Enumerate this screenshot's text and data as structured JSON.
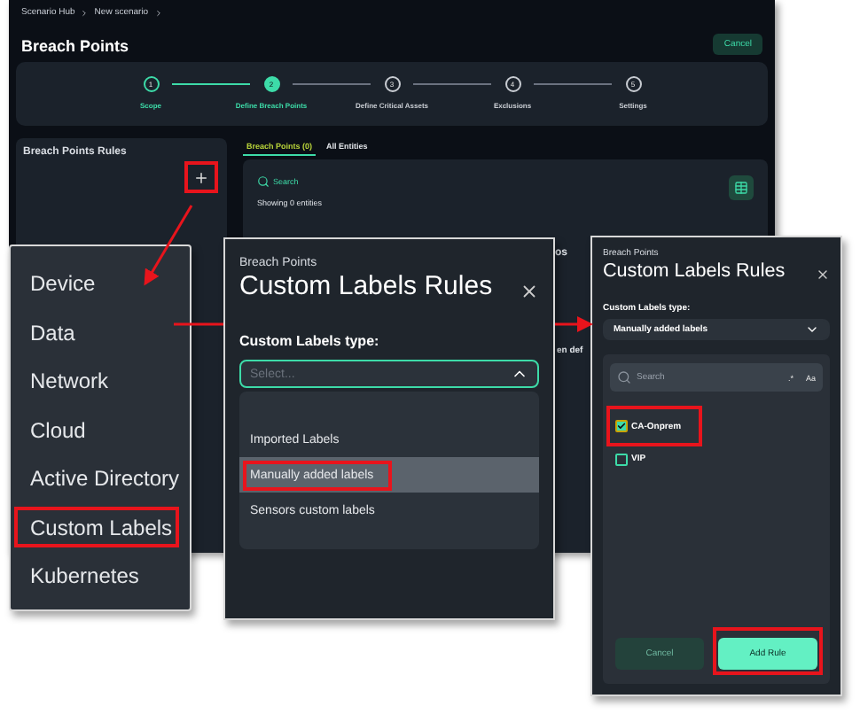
{
  "breadcrumb": [
    "Scenario Hub",
    "New scenario"
  ],
  "page_title": "Breach Points",
  "cancel_button": "Cancel",
  "steps": [
    {
      "number": "1",
      "label": "Scope",
      "completed": true,
      "selected": false
    },
    {
      "number": "2",
      "label": "Define Breach Points",
      "completed": false,
      "selected": true
    },
    {
      "number": "3",
      "label": "Define Critical Assets",
      "completed": false,
      "selected": false
    },
    {
      "number": "4",
      "label": "Exclusions",
      "completed": false,
      "selected": false
    },
    {
      "number": "5",
      "label": "Settings",
      "completed": false,
      "selected": false
    }
  ],
  "rules_panel": {
    "title": "Breach Points Rules",
    "add_highlighted": true
  },
  "tabs": [
    {
      "label": "Breach Points (0)",
      "selected": true
    },
    {
      "label": "All Entities",
      "selected": false
    }
  ],
  "search": {
    "placeholder": "Search"
  },
  "entities_count": "Showing 0 entities",
  "fragments": [
    "os",
    "en def"
  ],
  "rule_menu": [
    {
      "label": "Device",
      "highlighted": false
    },
    {
      "label": "Data",
      "highlighted": false
    },
    {
      "label": "Network",
      "highlighted": false
    },
    {
      "label": "Cloud",
      "highlighted": false
    },
    {
      "label": "Active Directory",
      "highlighted": false
    },
    {
      "label": "Custom Labels",
      "highlighted": true
    },
    {
      "label": "Kubernetes",
      "highlighted": false
    }
  ],
  "dialog_1": {
    "subtitle": "Breach Points",
    "title": "Custom Labels Rules",
    "field_label": "Custom Labels type:",
    "placeholder": "Select...",
    "expanded": true,
    "options": [
      {
        "label": "Imported Labels",
        "selected": false,
        "highlighted": false
      },
      {
        "label": "Manually added labels",
        "selected": true,
        "highlighted": true
      },
      {
        "label": "Sensors custom labels",
        "selected": false,
        "highlighted": false
      }
    ]
  },
  "dialog_2": {
    "subtitle": "Breach Points",
    "title": "Custom Labels Rules",
    "field_label": "Custom Labels type:",
    "value": "Manually added labels",
    "expanded": false,
    "search_placeholder": "Search",
    "regex_toggle": ".*",
    "case_toggle": "Aa",
    "labels": [
      {
        "label": "CA-Onprem",
        "checked": true,
        "highlighted": true
      },
      {
        "label": "VIP",
        "checked": false,
        "highlighted": false
      }
    ],
    "buttons": [
      {
        "label": "Cancel",
        "kind": "secondary",
        "highlighted": false
      },
      {
        "label": "Add Rule",
        "kind": "primary",
        "highlighted": true
      }
    ]
  }
}
